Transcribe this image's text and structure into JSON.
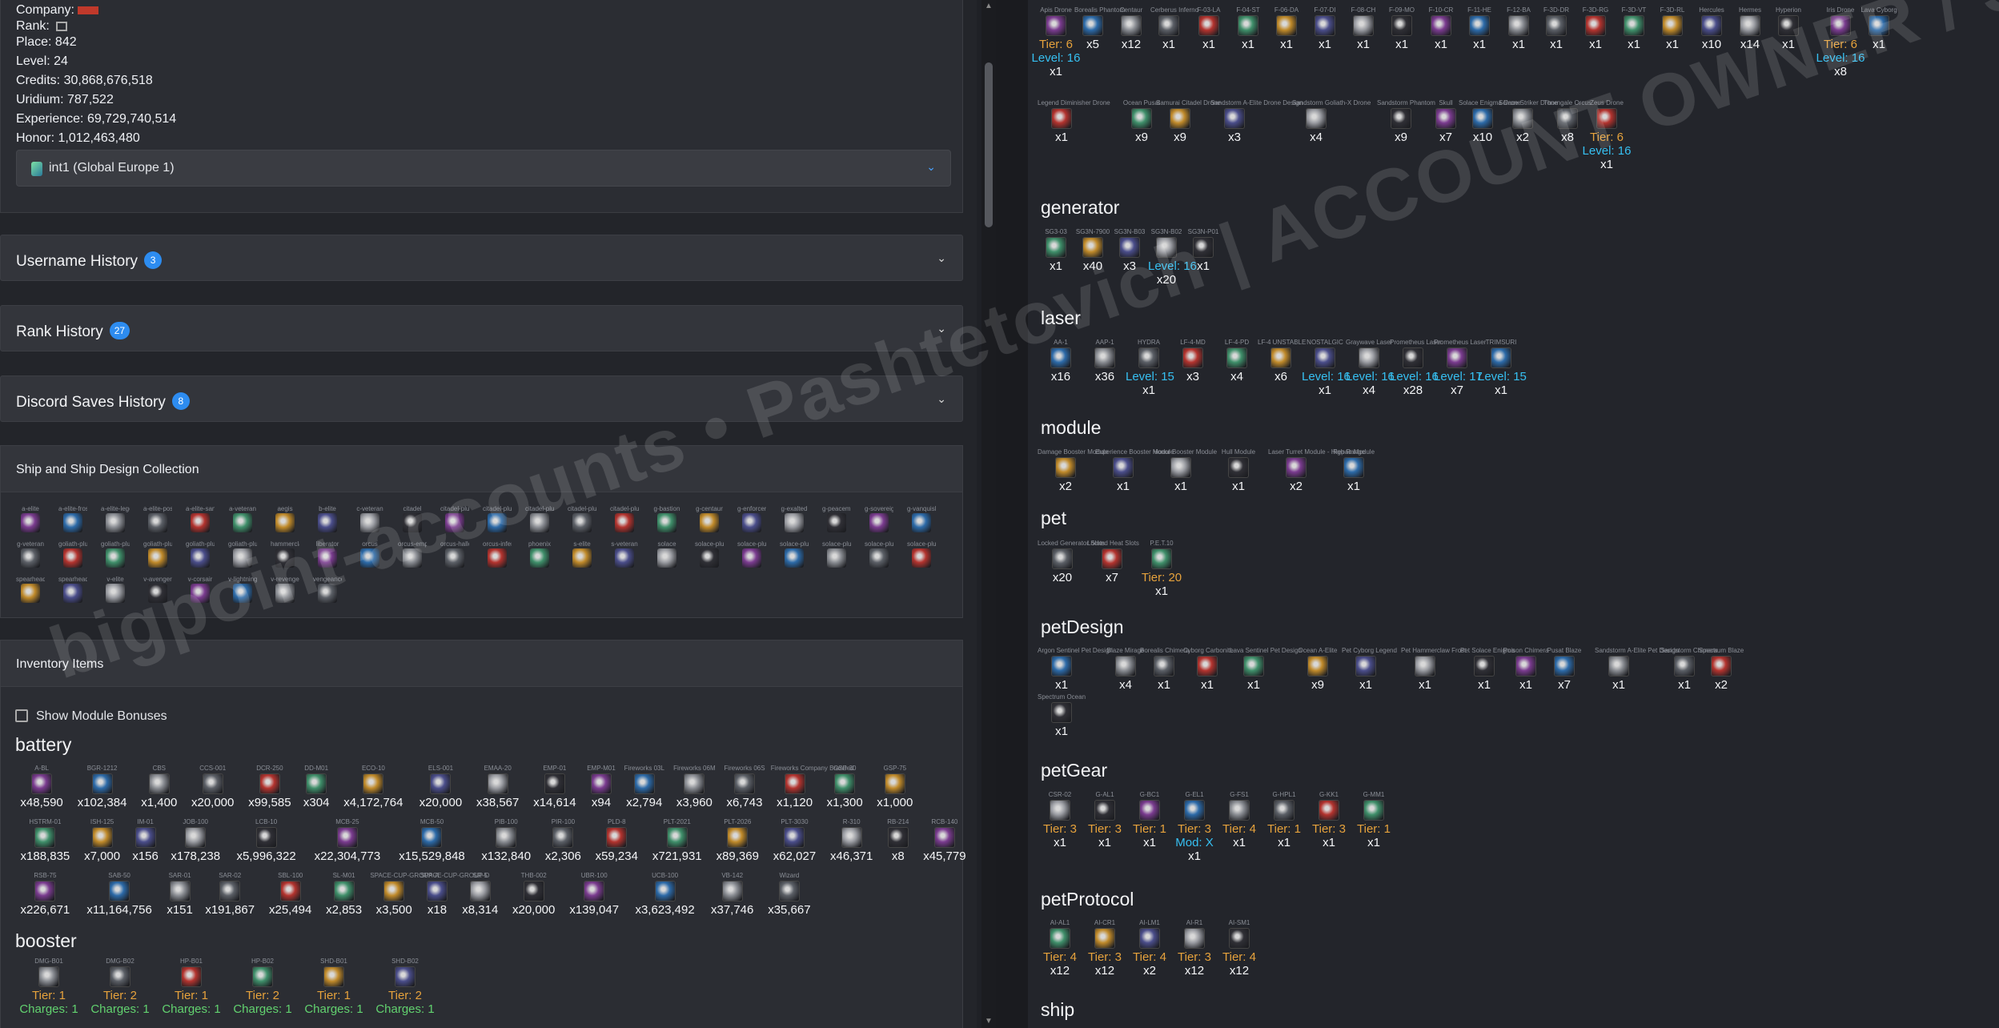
{
  "account": {
    "company_label": "Company:",
    "rank_label": "Rank:",
    "place": "Place: 842",
    "level": "Level: 24",
    "credits": "Credits: 30,868,676,518",
    "uridium": "Uridium: 787,522",
    "experience": "Experience: 69,729,740,514",
    "honor": "Honor: 1,012,463,480",
    "server": "int1 (Global Europe 1)"
  },
  "panels": {
    "username": {
      "title": "Username History",
      "count": "3"
    },
    "rank": {
      "title": "Rank History",
      "count": "27"
    },
    "discord": {
      "title": "Discord Saves History",
      "count": "8"
    }
  },
  "ship_section": {
    "title": "Ship and Ship Design Collection",
    "row1": [
      "a-elite",
      "a-elite-frost",
      "a-elite-legend",
      "a-elite-poseidon",
      "a-elite-sandstorm",
      "a-veteran",
      "aegis",
      "b-elite",
      "c-veteran",
      "citadel",
      "citadel-plus",
      "citadel-plus-frost",
      "citadel-plus-legend",
      "citadel-plus-prometheus",
      "citadel-plus-shogun",
      "g-bastion",
      "g-centaur",
      "g-enforcer",
      "g-exalted",
      "g-peacemaker",
      "g-sovereign",
      "g-vanquisher"
    ],
    "row2": [
      "g-veteran",
      "goliath-plus",
      "goliath-plus-amber",
      "goliath-plus-argon",
      "goliath-plus-carbonite",
      "goliath-plus-promethium",
      "hammerclaw",
      "liberator",
      "orcus",
      "orcus-empyrian",
      "orcus-halloween",
      "orcus-inferno",
      "phoenix",
      "s-elite",
      "s-veteran",
      "solace",
      "solace-plus",
      "solace-plus-asimov",
      "solace-plus-atlas",
      "solace-plus-poseidon",
      "solace-plus-tyrannosaurus",
      "solace-plus-ice"
    ],
    "row3": [
      "spearhead",
      "spearhead-empyrian",
      "v-elite",
      "v-avenger",
      "v-corsair",
      "v-lightning",
      "v-revenge",
      "vengeance"
    ]
  },
  "inventory": {
    "title": "Inventory Items",
    "show_bonus": "Show Module Bonuses",
    "battery_title": "battery",
    "booster_title": "booster",
    "battery_row1": [
      [
        "A-BL",
        "x48,590"
      ],
      [
        "BGR-1212",
        "x102,384"
      ],
      [
        "CBS",
        "x1,400"
      ],
      [
        "CCS-001",
        "x20,000"
      ],
      [
        "DCR-250",
        "x99,585"
      ],
      [
        "DD-M01",
        "x304"
      ],
      [
        "ECO-10",
        "x4,172,764"
      ],
      [
        "ELS-001",
        "x20,000"
      ],
      [
        "EMAA-20",
        "x38,567"
      ],
      [
        "EMP-01",
        "x14,614"
      ],
      [
        "EMP-M01",
        "x94"
      ],
      [
        "Fireworks 03L",
        "x2,794"
      ],
      [
        "Fireworks 06M",
        "x3,960"
      ],
      [
        "Fireworks 06S",
        "x6,743"
      ],
      [
        "Fireworks Company Branded",
        "x1,120"
      ],
      [
        "GSP-30",
        "x1,300"
      ],
      [
        "GSP-75",
        "x1,000"
      ]
    ],
    "battery_row2": [
      [
        "HSTRM-01",
        "x188,835"
      ],
      [
        "ISH-125",
        "x7,000"
      ],
      [
        "IM-01",
        "x156"
      ],
      [
        "JOB-100",
        "x178,238"
      ],
      [
        "LCB-10",
        "x5,996,322"
      ],
      [
        "MCB-25",
        "x22,304,773"
      ],
      [
        "MCB-50",
        "x15,529,848"
      ],
      [
        "PIB-100",
        "x132,840"
      ],
      [
        "PIR-100",
        "x2,306"
      ],
      [
        "PLD-8",
        "x59,234"
      ],
      [
        "PLT-2021",
        "x721,931"
      ],
      [
        "PLT-2026",
        "x89,369"
      ],
      [
        "PLT-3030",
        "x62,027"
      ],
      [
        "R-310",
        "x46,371"
      ],
      [
        "RB-214",
        "x8"
      ],
      [
        "RCB-140",
        "x45,779"
      ]
    ],
    "battery_row3": [
      [
        "RSB-75",
        "x226,671"
      ],
      [
        "SAB-50",
        "x11,164,756"
      ],
      [
        "SAR-01",
        "x151"
      ],
      [
        "SAR-02",
        "x191,867"
      ],
      [
        "SBL-100",
        "x25,494"
      ],
      [
        "SL-M01",
        "x2,853"
      ],
      [
        "SPACE-CUP-GROUP-A",
        "x3,500"
      ],
      [
        "SPACE-CUP-GROUP-D",
        "x18"
      ],
      [
        "SR-5",
        "x8,314"
      ],
      [
        "THB-002",
        "x20,000"
      ],
      [
        "UBR-100",
        "x139,047"
      ],
      [
        "UCB-100",
        "x3,623,492"
      ],
      [
        "VB-142",
        "x37,746"
      ],
      [
        "Wizard",
        "x35,667"
      ]
    ],
    "booster": [
      [
        "DMG-B01",
        "Tier: 1",
        "Charges: 1"
      ],
      [
        "DMG-B02",
        "Tier: 2",
        "Charges: 1"
      ],
      [
        "HP-B01",
        "Tier: 1",
        "Charges: 1"
      ],
      [
        "HP-B02",
        "Tier: 2",
        "Charges: 1"
      ],
      [
        "SHD-B01",
        "Tier: 1",
        "Charges: 1"
      ],
      [
        "SHD-B02",
        "Tier: 2",
        "Charges: 1"
      ]
    ]
  },
  "right": {
    "drones_row1": [
      [
        "Apis Drone",
        "Tier: 6",
        "Level: 16",
        "x1"
      ],
      [
        "Borealis Phantom",
        "",
        "",
        "x5"
      ],
      [
        "Centaur",
        "",
        "",
        "x12"
      ],
      [
        "Cerberus Inferno",
        "",
        "",
        "x1"
      ],
      [
        "F-03-LA",
        "",
        "",
        "x1"
      ],
      [
        "F-04-ST",
        "",
        "",
        "x1"
      ],
      [
        "F-06-DA",
        "",
        "",
        "x1"
      ],
      [
        "F-07-DI",
        "",
        "",
        "x1"
      ],
      [
        "F-08-CH",
        "",
        "",
        "x1"
      ],
      [
        "F-09-MO",
        "",
        "",
        "x1"
      ],
      [
        "F-10-CR",
        "",
        "",
        "x1"
      ],
      [
        "F-11-HE",
        "",
        "",
        "x1"
      ],
      [
        "F-12-BA",
        "",
        "",
        "x1"
      ],
      [
        "F-3D-DR",
        "",
        "",
        "x1"
      ],
      [
        "F-3D-RG",
        "",
        "",
        "x1"
      ],
      [
        "F-3D-VT",
        "",
        "",
        "x1"
      ],
      [
        "F-3D-RL",
        "",
        "",
        "x1"
      ],
      [
        "Hercules",
        "",
        "",
        "x10"
      ],
      [
        "Hermes",
        "",
        "",
        "x14"
      ],
      [
        "Hyperion",
        "",
        "",
        "x1"
      ],
      [
        "Iris Drone",
        "Tier: 6",
        "Level: 16",
        "x8"
      ],
      [
        "Lava Cyborg",
        "",
        "",
        "x1"
      ]
    ],
    "drones_row2": [
      [
        "Legend Diminisher Drone",
        "",
        "",
        "x1"
      ],
      [
        "Ocean Pusat",
        "",
        "",
        "x9"
      ],
      [
        "Samurai Citadel Drone",
        "",
        "",
        "x9"
      ],
      [
        "Sandstorm A-Elite Drone Design",
        "",
        "",
        "x3"
      ],
      [
        "Sandstorm Goliath-X Drone",
        "",
        "",
        "x4"
      ],
      [
        "Sandstorm Phantom",
        "",
        "",
        "x9"
      ],
      [
        "Skull",
        "",
        "",
        "x7"
      ],
      [
        "Solace Enigma Drone",
        "",
        "",
        "x10"
      ],
      [
        "Solace Striker Drone",
        "",
        "",
        "x2"
      ],
      [
        "Thorngale Orcus",
        "",
        "",
        "x8"
      ],
      [
        "Zeus Drone",
        "Tier: 6",
        "Level: 16",
        "x1"
      ]
    ],
    "generator_title": "generator",
    "generator": [
      [
        "SG3-03",
        "",
        "",
        "x1"
      ],
      [
        "SG3N-7900",
        "",
        "",
        "x40"
      ],
      [
        "SG3N-B03",
        "",
        "",
        "x3"
      ],
      [
        "SG3N-B02",
        "",
        "Level: 16",
        "x20"
      ],
      [
        "SG3N-P01",
        "",
        "",
        "x1"
      ]
    ],
    "laser_title": "laser",
    "laser": [
      [
        "AA-1",
        "",
        "",
        "x16"
      ],
      [
        "AAP-1",
        "",
        "",
        "x36"
      ],
      [
        "HYDRA",
        "",
        "Level: 15",
        "x1"
      ],
      [
        "LF-4-MD",
        "",
        "",
        "x3"
      ],
      [
        "LF-4-PD",
        "",
        "",
        "x4"
      ],
      [
        "LF-4 UNSTABLE",
        "",
        "",
        "x6"
      ],
      [
        "NOSTALGIC",
        "",
        "Level: 16",
        "x1"
      ],
      [
        "Graywave Laser",
        "",
        "Level: 16",
        "x4"
      ],
      [
        "Prometheus Laser",
        "",
        "Level: 16",
        "x28"
      ],
      [
        "Prometheus Laser",
        "",
        "Level: 17",
        "x7"
      ],
      [
        "TRIMSURI",
        "",
        "Level: 15",
        "x1"
      ]
    ],
    "module_title": "module",
    "module": [
      [
        "Damage Booster Module",
        "",
        "",
        "x2"
      ],
      [
        "Experience Booster Module",
        "",
        "",
        "x1"
      ],
      [
        "Honor Booster Module",
        "",
        "",
        "x1"
      ],
      [
        "Hull Module",
        "",
        "",
        "x1"
      ],
      [
        "Laser Turret Module - High Range",
        "",
        "",
        "x2"
      ],
      [
        "Repair Module",
        "",
        "",
        "x1"
      ]
    ],
    "pet_title": "pet",
    "pet": [
      [
        "Locked Generator Slots",
        "",
        "",
        "x20"
      ],
      [
        "Locked Heat Slots",
        "",
        "",
        "x7"
      ],
      [
        "P.E.T.10",
        "Tier: 20",
        "",
        "x1"
      ]
    ],
    "petdesign_title": "petDesign",
    "petdesign": [
      [
        "Argon Sentinel Pet Design",
        "",
        "",
        "x1"
      ],
      [
        "Blaze Mirage",
        "",
        "",
        "x4"
      ],
      [
        "Borealis Chimera",
        "",
        "",
        "x1"
      ],
      [
        "Cyborg Carbonite",
        "",
        "",
        "x1"
      ],
      [
        "Lava Sentinel Pet Design",
        "",
        "",
        "x1"
      ],
      [
        "Ocean A-Elite",
        "",
        "",
        "x9"
      ],
      [
        "Pet Cyborg Legend",
        "",
        "",
        "x1"
      ],
      [
        "Pet Hammerclaw Frost",
        "",
        "",
        "x1"
      ],
      [
        "Pet Solace Enigma",
        "",
        "",
        "x1"
      ],
      [
        "Poison Chimera",
        "",
        "",
        "x1"
      ],
      [
        "Pusat Blaze",
        "",
        "",
        "x7"
      ],
      [
        "Sandstorm A-Elite Pet Design",
        "",
        "",
        "x1"
      ],
      [
        "Sandstorm Chimera",
        "",
        "",
        "x1"
      ],
      [
        "Spectrum Blaze",
        "",
        "",
        "x2"
      ],
      [
        "Spectrum Ocean",
        "",
        "",
        "x1"
      ]
    ],
    "petgear_title": "petGear",
    "petgear": [
      [
        "CSR-02",
        "Tier: 3",
        "",
        "x1"
      ],
      [
        "G-AL1",
        "Tier: 3",
        "",
        "x1"
      ],
      [
        "G-BC1",
        "Tier: 1",
        "",
        "x1"
      ],
      [
        "G-EL1",
        "Tier: 3",
        "Mod: X",
        "x1"
      ],
      [
        "G-FS1",
        "Tier: 4",
        "",
        "x1"
      ],
      [
        "G-HPL1",
        "Tier: 1",
        "",
        "x1"
      ],
      [
        "G-KK1",
        "Tier: 3",
        "",
        "x1"
      ],
      [
        "G-MM1",
        "Tier: 1",
        "",
        "x1"
      ]
    ],
    "petprotocol_title": "petProtocol",
    "petprotocol": [
      [
        "AI-AL1",
        "Tier: 4",
        "",
        "x12"
      ],
      [
        "AI-CR1",
        "Tier: 3",
        "",
        "x12"
      ],
      [
        "AI-LM1",
        "Tier: 4",
        "",
        "x2"
      ],
      [
        "AI-R1",
        "Tier: 3",
        "",
        "x12"
      ],
      [
        "AI-SM1",
        "Tier: 4",
        "",
        "x12"
      ]
    ],
    "ship_title": "ship"
  },
  "watermark": "bigpoint-accounts • Pashtetovich | ACCOUNT OWNER / SELLER",
  "colors": {
    "tier": "#e6a23c",
    "level": "#36c0f2",
    "charges": "#62d26f",
    "badge": "#2d8cf0"
  }
}
